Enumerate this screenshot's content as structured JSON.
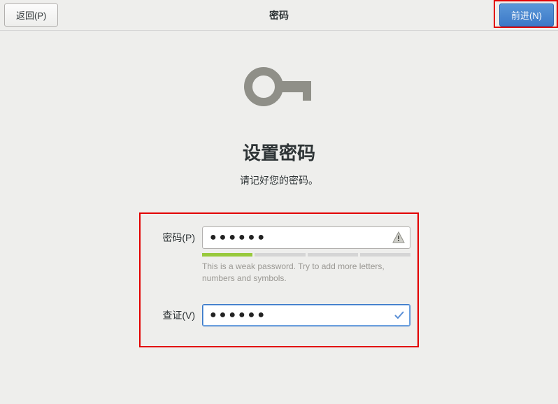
{
  "header": {
    "back_label": "返回(P)",
    "title": "密码",
    "next_label": "前进(N)"
  },
  "main": {
    "heading": "设置密码",
    "subheading": "请记好您的密码。",
    "password_label": "密码(P)",
    "verify_label": "查证(V)",
    "password_value": "●●●●●●",
    "verify_value": "●●●●●●",
    "hint": "This is a weak password. Try to add more letters, numbers and symbols.",
    "strength_level": 1,
    "strength_segments": 4
  }
}
